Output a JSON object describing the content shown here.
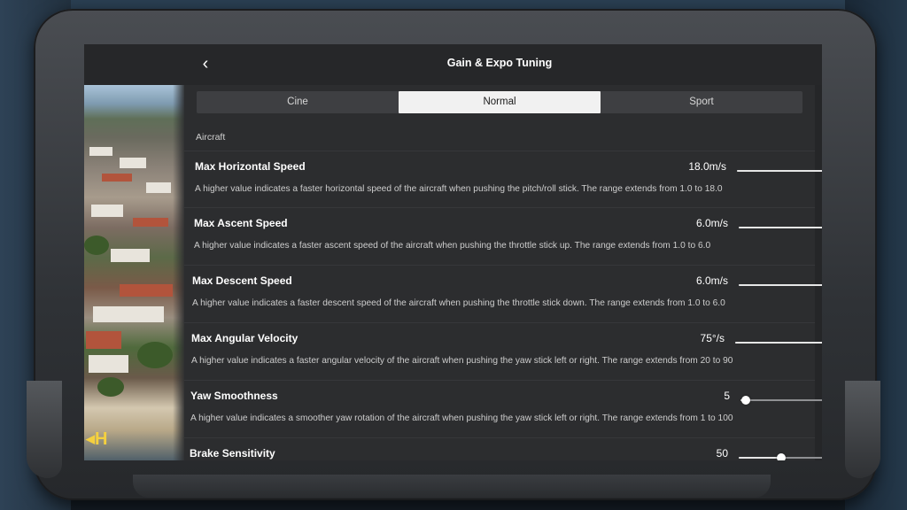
{
  "header": {
    "title": "Gain & Expo Tuning",
    "back_icon": "chevron-left-icon"
  },
  "modes": {
    "items": [
      "Cine",
      "Normal",
      "Sport"
    ],
    "selected": "Normal"
  },
  "section_label": "Aircraft",
  "settings": [
    {
      "name": "Max Horizontal Speed",
      "value": "18.0m/s",
      "fraction": 1.0,
      "description": "A higher value indicates a faster horizontal speed of the aircraft when pushing the pitch/roll stick. The range extends from 1.0 to 18.0"
    },
    {
      "name": "Max Ascent Speed",
      "value": "6.0m/s",
      "fraction": 1.0,
      "description": "A higher value indicates a faster ascent speed of the aircraft when pushing the throttle stick up. The range extends from 1.0 to 6.0"
    },
    {
      "name": "Max Descent Speed",
      "value": "6.0m/s",
      "fraction": 1.0,
      "description": "A higher value indicates a faster descent speed of the aircraft when pushing the throttle stick down. The range extends from 1.0 to 6.0"
    },
    {
      "name": "Max Angular Velocity",
      "value": "75°/s",
      "fraction": 0.79,
      "description": "A higher value indicates a faster angular velocity of the aircraft when pushing the yaw stick left or right. The range extends from 20 to 90"
    },
    {
      "name": "Yaw Smoothness",
      "value": "5",
      "fraction": 0.04,
      "description": "A higher value indicates a smoother yaw rotation of the aircraft when pushing the yaw stick left or right. The range extends from 1 to 100"
    },
    {
      "name": "Brake Sensitivity",
      "value": "50",
      "fraction": 0.29,
      "description": ""
    }
  ],
  "colors": {
    "accent_track": "#e6e6e6",
    "panel": "#2c2d2f",
    "selected_segment": "#f1f1f1"
  }
}
